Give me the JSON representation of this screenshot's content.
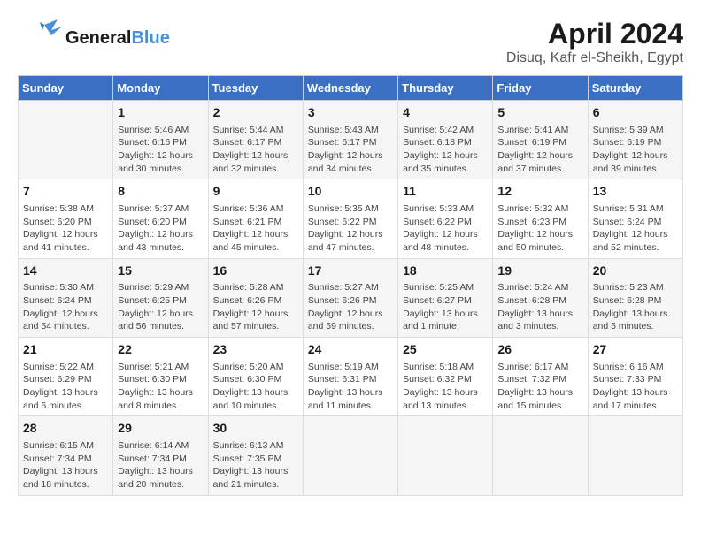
{
  "header": {
    "logo_general": "General",
    "logo_blue": "Blue",
    "title": "April 2024",
    "subtitle": "Disuq, Kafr el-Sheikh, Egypt"
  },
  "columns": [
    "Sunday",
    "Monday",
    "Tuesday",
    "Wednesday",
    "Thursday",
    "Friday",
    "Saturday"
  ],
  "weeks": [
    {
      "cells": [
        {
          "day": "",
          "info": ""
        },
        {
          "day": "1",
          "info": "Sunrise: 5:46 AM\nSunset: 6:16 PM\nDaylight: 12 hours\nand 30 minutes."
        },
        {
          "day": "2",
          "info": "Sunrise: 5:44 AM\nSunset: 6:17 PM\nDaylight: 12 hours\nand 32 minutes."
        },
        {
          "day": "3",
          "info": "Sunrise: 5:43 AM\nSunset: 6:17 PM\nDaylight: 12 hours\nand 34 minutes."
        },
        {
          "day": "4",
          "info": "Sunrise: 5:42 AM\nSunset: 6:18 PM\nDaylight: 12 hours\nand 35 minutes."
        },
        {
          "day": "5",
          "info": "Sunrise: 5:41 AM\nSunset: 6:19 PM\nDaylight: 12 hours\nand 37 minutes."
        },
        {
          "day": "6",
          "info": "Sunrise: 5:39 AM\nSunset: 6:19 PM\nDaylight: 12 hours\nand 39 minutes."
        }
      ]
    },
    {
      "cells": [
        {
          "day": "7",
          "info": "Sunrise: 5:38 AM\nSunset: 6:20 PM\nDaylight: 12 hours\nand 41 minutes."
        },
        {
          "day": "8",
          "info": "Sunrise: 5:37 AM\nSunset: 6:20 PM\nDaylight: 12 hours\nand 43 minutes."
        },
        {
          "day": "9",
          "info": "Sunrise: 5:36 AM\nSunset: 6:21 PM\nDaylight: 12 hours\nand 45 minutes."
        },
        {
          "day": "10",
          "info": "Sunrise: 5:35 AM\nSunset: 6:22 PM\nDaylight: 12 hours\nand 47 minutes."
        },
        {
          "day": "11",
          "info": "Sunrise: 5:33 AM\nSunset: 6:22 PM\nDaylight: 12 hours\nand 48 minutes."
        },
        {
          "day": "12",
          "info": "Sunrise: 5:32 AM\nSunset: 6:23 PM\nDaylight: 12 hours\nand 50 minutes."
        },
        {
          "day": "13",
          "info": "Sunrise: 5:31 AM\nSunset: 6:24 PM\nDaylight: 12 hours\nand 52 minutes."
        }
      ]
    },
    {
      "cells": [
        {
          "day": "14",
          "info": "Sunrise: 5:30 AM\nSunset: 6:24 PM\nDaylight: 12 hours\nand 54 minutes."
        },
        {
          "day": "15",
          "info": "Sunrise: 5:29 AM\nSunset: 6:25 PM\nDaylight: 12 hours\nand 56 minutes."
        },
        {
          "day": "16",
          "info": "Sunrise: 5:28 AM\nSunset: 6:26 PM\nDaylight: 12 hours\nand 57 minutes."
        },
        {
          "day": "17",
          "info": "Sunrise: 5:27 AM\nSunset: 6:26 PM\nDaylight: 12 hours\nand 59 minutes."
        },
        {
          "day": "18",
          "info": "Sunrise: 5:25 AM\nSunset: 6:27 PM\nDaylight: 13 hours\nand 1 minute."
        },
        {
          "day": "19",
          "info": "Sunrise: 5:24 AM\nSunset: 6:28 PM\nDaylight: 13 hours\nand 3 minutes."
        },
        {
          "day": "20",
          "info": "Sunrise: 5:23 AM\nSunset: 6:28 PM\nDaylight: 13 hours\nand 5 minutes."
        }
      ]
    },
    {
      "cells": [
        {
          "day": "21",
          "info": "Sunrise: 5:22 AM\nSunset: 6:29 PM\nDaylight: 13 hours\nand 6 minutes."
        },
        {
          "day": "22",
          "info": "Sunrise: 5:21 AM\nSunset: 6:30 PM\nDaylight: 13 hours\nand 8 minutes."
        },
        {
          "day": "23",
          "info": "Sunrise: 5:20 AM\nSunset: 6:30 PM\nDaylight: 13 hours\nand 10 minutes."
        },
        {
          "day": "24",
          "info": "Sunrise: 5:19 AM\nSunset: 6:31 PM\nDaylight: 13 hours\nand 11 minutes."
        },
        {
          "day": "25",
          "info": "Sunrise: 5:18 AM\nSunset: 6:32 PM\nDaylight: 13 hours\nand 13 minutes."
        },
        {
          "day": "26",
          "info": "Sunrise: 6:17 AM\nSunset: 7:32 PM\nDaylight: 13 hours\nand 15 minutes."
        },
        {
          "day": "27",
          "info": "Sunrise: 6:16 AM\nSunset: 7:33 PM\nDaylight: 13 hours\nand 17 minutes."
        }
      ]
    },
    {
      "cells": [
        {
          "day": "28",
          "info": "Sunrise: 6:15 AM\nSunset: 7:34 PM\nDaylight: 13 hours\nand 18 minutes."
        },
        {
          "day": "29",
          "info": "Sunrise: 6:14 AM\nSunset: 7:34 PM\nDaylight: 13 hours\nand 20 minutes."
        },
        {
          "day": "30",
          "info": "Sunrise: 6:13 AM\nSunset: 7:35 PM\nDaylight: 13 hours\nand 21 minutes."
        },
        {
          "day": "",
          "info": ""
        },
        {
          "day": "",
          "info": ""
        },
        {
          "day": "",
          "info": ""
        },
        {
          "day": "",
          "info": ""
        }
      ]
    }
  ]
}
